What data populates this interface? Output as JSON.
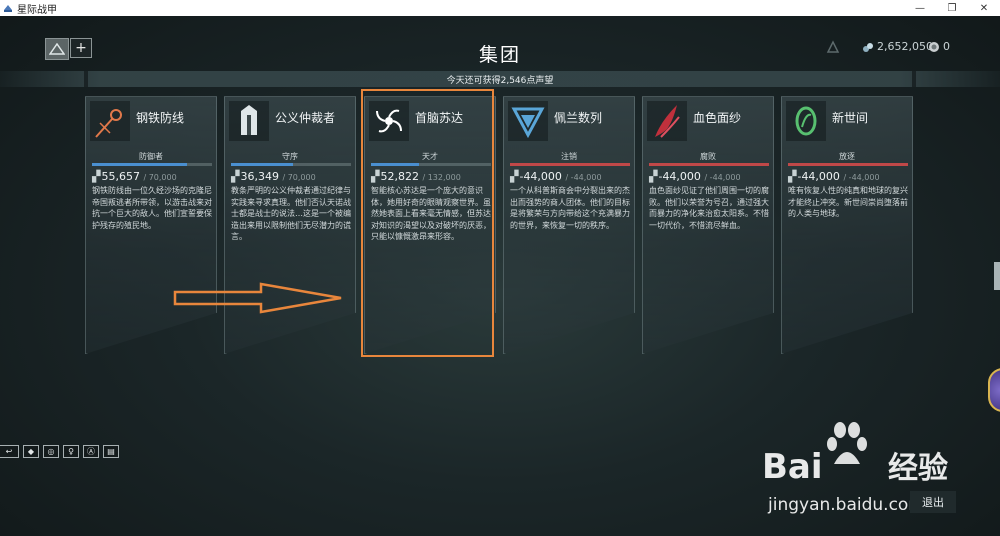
{
  "window": {
    "title": "星际战甲",
    "minimize": "—",
    "maximize": "❐",
    "close": "✕"
  },
  "header": {
    "title": "集团",
    "add_label": "+",
    "credits": "2,652,050",
    "platinum": "0"
  },
  "standing_notice": "今天还可获得2,546点声望",
  "syndicates": [
    {
      "name": "钢铁防线",
      "rank": "防御者",
      "standing": "55,657",
      "max": "/ 70,000",
      "progress": 0.795,
      "bar_color": "#4a8fd0",
      "icon": "steel-meridian-icon",
      "icon_color": "#e0784a",
      "description": "钢铁防线由一位久经沙场的克隆尼帝国叛逃者所带领，以游击战来对抗一个巨大的敌人。他们宣誓要保护残存的殖民地。"
    },
    {
      "name": "公义仲裁者",
      "rank": "守序",
      "standing": "36,349",
      "max": "/ 70,000",
      "progress": 0.519,
      "bar_color": "#4a8fd0",
      "icon": "arbiters-of-hexis-icon",
      "icon_color": "#e6ecee",
      "description": "教条严明的公义仲裁者通过纪律与实践来寻求真理。他们否认天诺战士都是战士的说法…这是一个被编造出来用以限制他们无尽潜力的谎言。"
    },
    {
      "name": "首脑苏达",
      "rank": "天才",
      "standing": "52,822",
      "max": "/ 132,000",
      "progress": 0.4,
      "bar_color": "#4a8fd0",
      "icon": "cephalon-suda-icon",
      "icon_color": "#ffffff",
      "description": "智能核心苏达是一个庞大的意识体，她用好奇的眼睛观察世界。虽然她表面上看来毫无情感，但苏达对知识的渴望以及对破坏的厌恶，只能以慷慨激昂来形容。"
    },
    {
      "name": "佩兰数列",
      "rank": "注销",
      "standing": "-44,000",
      "max": "/ -44,000",
      "progress": 1.0,
      "bar_color": "#c04848",
      "icon": "perrin-sequence-icon",
      "icon_color": "#5aa6d8",
      "description": "一个从科普斯商会中分裂出来的杰出而强势的商人团体。他们的目标是将繁荣与方向带给这个充满暴力的世界，来恢复一切的秩序。"
    },
    {
      "name": "血色面纱",
      "rank": "腐败",
      "standing": "-44,000",
      "max": "/ -44,000",
      "progress": 1.0,
      "bar_color": "#c04848",
      "icon": "red-veil-icon",
      "icon_color": "#c0303c",
      "description": "血色面纱见证了他们周围一切的腐败。他们以荣誉为号召，通过强大而暴力的净化来治愈太阳系。不惜一切代价，不惜流尽鲜血。"
    },
    {
      "name": "新世间",
      "rank": "放逐",
      "standing": "-44,000",
      "max": "/ -44,000",
      "progress": 1.0,
      "bar_color": "#c04848",
      "icon": "new-loka-icon",
      "icon_color": "#58c070",
      "description": "唯有恢复人性的纯真和地球的复兴才能终止冲突。新世间崇尚堕落前的人类与地球。"
    }
  ],
  "bottom_toolbar": [
    "↩",
    "◆",
    "◎",
    "♀",
    "Ⓐ",
    "▤"
  ],
  "exit_label": "退出",
  "watermark": {
    "brand": "Bai",
    "brand_cn": "经验",
    "url": "jingyan.baidu.com"
  }
}
